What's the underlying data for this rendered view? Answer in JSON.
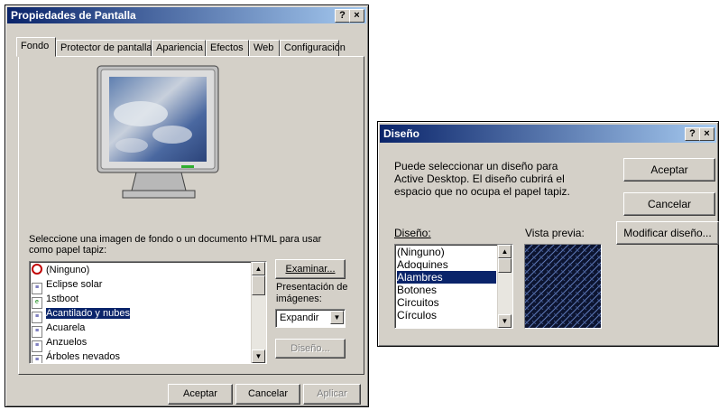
{
  "main_dialog": {
    "title": "Propiedades de Pantalla",
    "help_btn": "?",
    "close_btn": "×",
    "tabs": [
      "Fondo",
      "Protector de pantalla",
      "Apariencia",
      "Efectos",
      "Web",
      "Configuración"
    ],
    "wallpaper_prompt": "Seleccione una imagen de fondo o un documento HTML para usar como papel tapiz:",
    "wallpaper_items": [
      {
        "label": "(Ninguno)",
        "icon": "none-icon",
        "selected": false
      },
      {
        "label": "Eclipse solar",
        "icon": "image-file-icon",
        "selected": false
      },
      {
        "label": "1stboot",
        "icon": "html-file-icon",
        "selected": false
      },
      {
        "label": "Acantilado y nubes",
        "icon": "image-file-icon",
        "selected": true
      },
      {
        "label": "Acuarela",
        "icon": "image-file-icon",
        "selected": false
      },
      {
        "label": "Anzuelos",
        "icon": "image-file-icon",
        "selected": false
      },
      {
        "label": "Árboles nevados",
        "icon": "image-file-icon",
        "selected": false
      }
    ],
    "browse_btn": "Examinar...",
    "display_label": "Presentación de imágenes:",
    "display_value": "Expandir",
    "design_btn": "Diseño...",
    "ok_btn": "Aceptar",
    "cancel_btn": "Cancelar",
    "apply_btn": "Aplicar"
  },
  "pattern_dialog": {
    "title": "Diseño",
    "help_btn": "?",
    "close_btn": "×",
    "description": "Puede seleccionar un diseño para Active Desktop. El diseño cubrirá el espacio que no ocupa el papel tapiz.",
    "list_label": "Diseño:",
    "preview_label": "Vista previa:",
    "patterns": [
      {
        "label": "(Ninguno)",
        "selected": false
      },
      {
        "label": "Adoquines",
        "selected": false
      },
      {
        "label": "Alambres",
        "selected": true
      },
      {
        "label": "Botones",
        "selected": false
      },
      {
        "label": "Circuitos",
        "selected": false
      },
      {
        "label": "Círculos",
        "selected": false
      }
    ],
    "ok_btn": "Aceptar",
    "cancel_btn": "Cancelar",
    "modify_btn": "Modificar diseño..."
  },
  "colors": {
    "title_active": "#0a246a",
    "face": "#d4d0c8",
    "selection": "#0a246a",
    "preview_pattern": "#1a2a55"
  }
}
